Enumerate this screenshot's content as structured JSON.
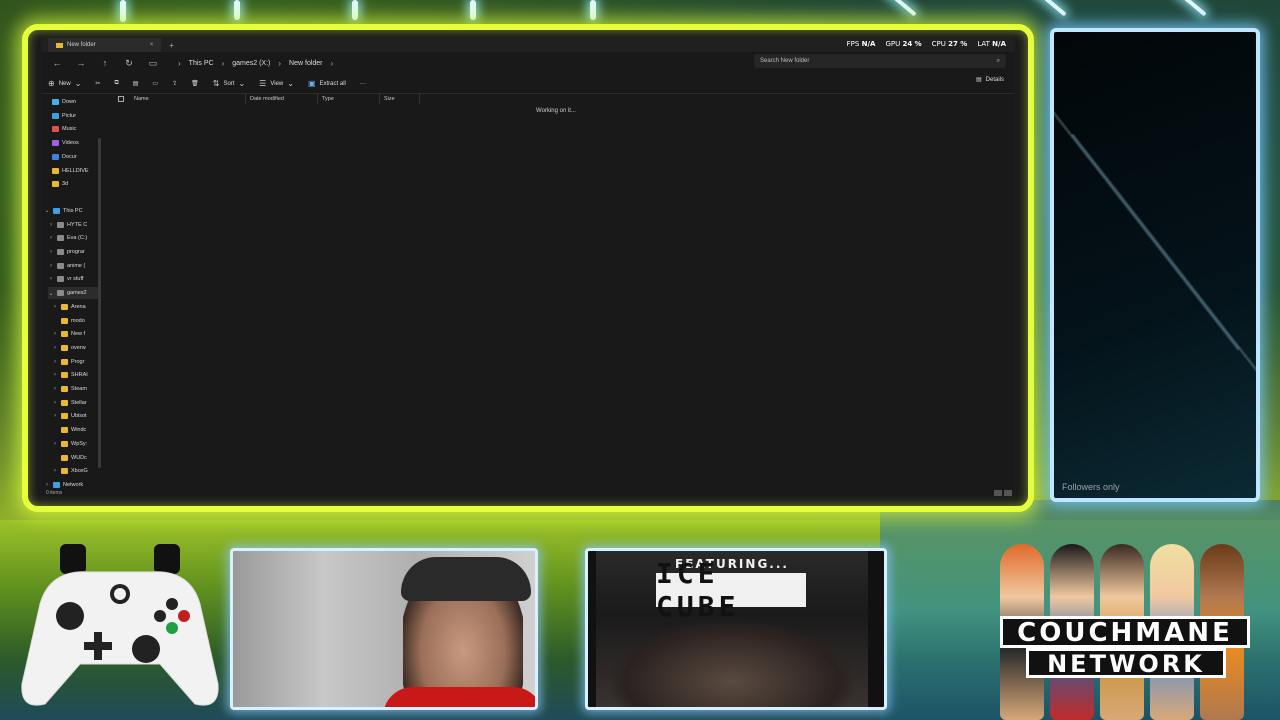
{
  "explorer": {
    "tab_title": "New folder",
    "perf": [
      {
        "label": "FPS",
        "value": "N/A"
      },
      {
        "label": "GPU",
        "value": "24 %"
      },
      {
        "label": "CPU",
        "value": "27 %"
      },
      {
        "label": "LAT",
        "value": "N/A"
      }
    ],
    "breadcrumbs": [
      "This PC",
      "games2 (X:)",
      "New folder"
    ],
    "search_placeholder": "Search New folder",
    "toolbar": {
      "new_label": "New",
      "sort_label": "Sort",
      "view_label": "View",
      "extract_label": "Extract all",
      "more_label": "···",
      "details_label": "Details"
    },
    "nav_quick": [
      {
        "label": "Down",
        "color": "#3fb0f0"
      },
      {
        "label": "Pictur",
        "color": "#3fa0e0"
      },
      {
        "label": "Music",
        "color": "#e05050"
      },
      {
        "label": "Videos",
        "color": "#a060e0"
      },
      {
        "label": "Docur",
        "color": "#4080e0"
      },
      {
        "label": "HELLDIVE",
        "color": "#e8b830"
      },
      {
        "label": "3d",
        "color": "#e8b830"
      }
    ],
    "nav_pc": [
      {
        "label": "This PC",
        "level": 0,
        "chev": "⌄"
      },
      {
        "label": "HYTE C",
        "level": 1,
        "chev": "›"
      },
      {
        "label": "Eva (C:)",
        "level": 1,
        "chev": "›"
      },
      {
        "label": "prograr",
        "level": 1,
        "chev": "›"
      },
      {
        "label": "anime (",
        "level": 1,
        "chev": "›"
      },
      {
        "label": "vr stuff",
        "level": 1,
        "chev": "›"
      },
      {
        "label": "games2",
        "level": 1,
        "chev": "⌄"
      },
      {
        "label": "Arena",
        "level": 2,
        "chev": "›"
      },
      {
        "label": "modo",
        "level": 2,
        "chev": ""
      },
      {
        "label": "New f",
        "level": 2,
        "chev": "›"
      },
      {
        "label": "overw",
        "level": 2,
        "chev": "›"
      },
      {
        "label": "Progr",
        "level": 2,
        "chev": "›"
      },
      {
        "label": "SHRAI",
        "level": 2,
        "chev": "›"
      },
      {
        "label": "Steam",
        "level": 2,
        "chev": "›"
      },
      {
        "label": "Stellar",
        "level": 2,
        "chev": "›"
      },
      {
        "label": "Ubisot",
        "level": 2,
        "chev": "›"
      },
      {
        "label": "Windc",
        "level": 2,
        "chev": ""
      },
      {
        "label": "WpSy:",
        "level": 2,
        "chev": "›"
      },
      {
        "label": "WUDc",
        "level": 2,
        "chev": ""
      },
      {
        "label": "XboxG",
        "level": 2,
        "chev": "›"
      },
      {
        "label": "Network",
        "level": 0,
        "chev": "›"
      }
    ],
    "columns": [
      "Name",
      "Date modified",
      "Type",
      "Size"
    ],
    "working_text": "Working on it...",
    "status_text": "0 items"
  },
  "chat": {
    "followers_text": "Followers only"
  },
  "media": {
    "featuring_text": "FEATURING...",
    "title_text": "ICE CUBE"
  },
  "logo": {
    "line1": "COUCHMANE",
    "line2": "NETWORK"
  }
}
